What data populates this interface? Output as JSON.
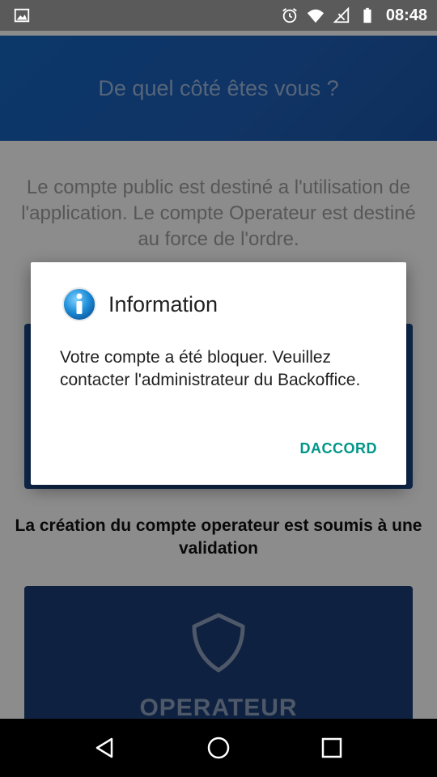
{
  "status_bar": {
    "time": "08:48",
    "icons": [
      "image-icon",
      "alarm-icon",
      "wifi-icon",
      "no-signal-icon",
      "battery-icon"
    ]
  },
  "header": {
    "title": "De quel côté êtes vous ?",
    "color": "#1565c0"
  },
  "intro": {
    "text": "Le compte public est destiné a l'utilisation de l'application. Le compte Operateur est destiné au force de l'ordre."
  },
  "operator_note": {
    "text": "La création du compte operateur est soumis à une validation"
  },
  "operator_card": {
    "label": "OPERATEUR",
    "icon": "shield-icon"
  },
  "dialog": {
    "icon": "info-icon",
    "title": "Information",
    "message": "Votre compte a été bloquer. Veuillez contacter l'administrateur du Backoffice.",
    "button_label": "DACCORD",
    "accent": "#009688"
  },
  "nav_bar": {
    "buttons": [
      "back-icon",
      "home-icon",
      "recents-icon"
    ]
  }
}
